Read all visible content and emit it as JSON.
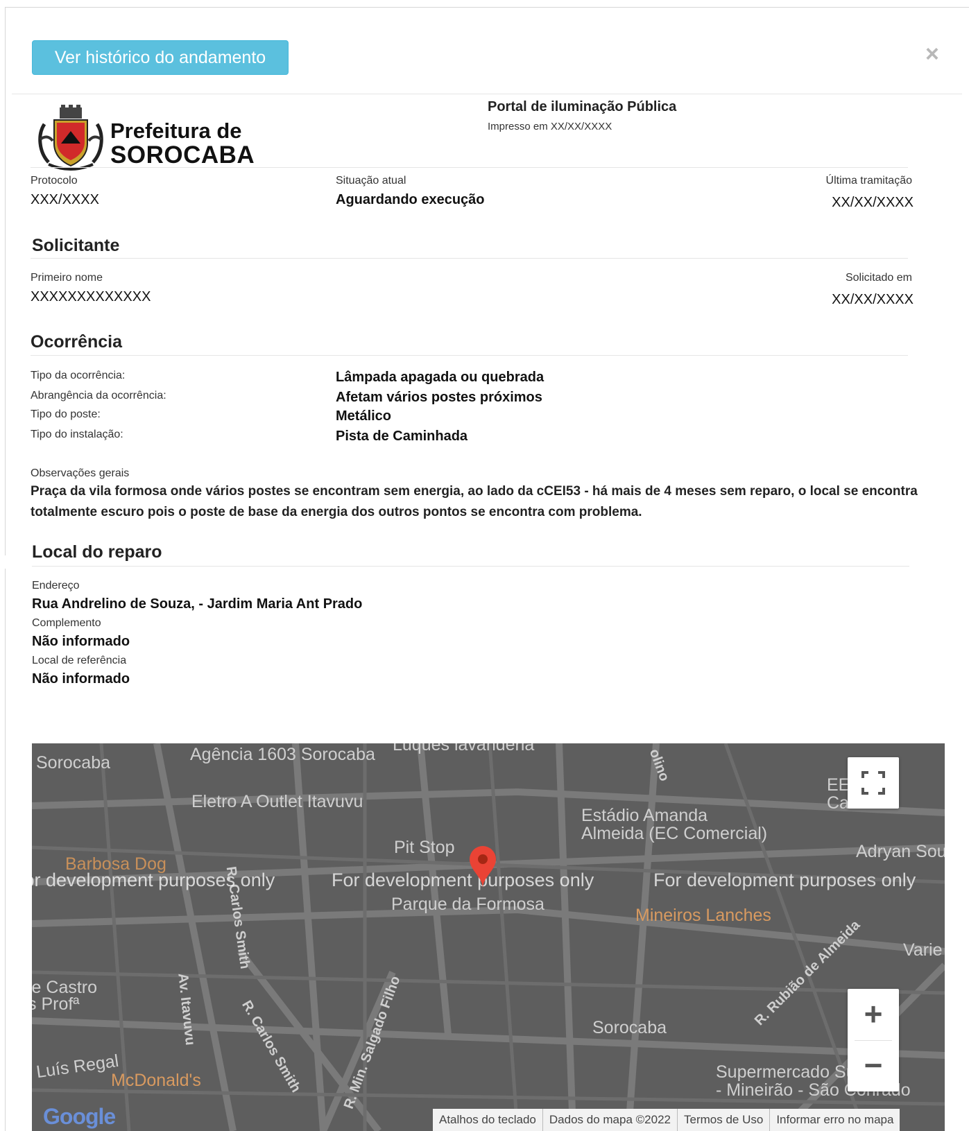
{
  "header": {
    "history_button": "Ver histórico do andamento",
    "close_symbol": "×"
  },
  "brand": {
    "line1": "Prefeitura de",
    "line2": "SOROCABA"
  },
  "portal": {
    "title": "Portal de iluminação Pública",
    "printed": "Impresso em XX/XX/XXXX"
  },
  "status": {
    "protocol_label": "Protocolo",
    "protocol_value": "XXX/XXXX",
    "situation_label": "Situação atual",
    "situation_value": "Aguardando execução",
    "last_label": "Última tramitação",
    "last_value": "XX/XX/XXXX"
  },
  "requester": {
    "heading": "Solicitante",
    "name_label": "Primeiro nome",
    "name_value": "XXXXXXXXXXXXX",
    "date_label": "Solicitado em",
    "date_value": "XX/XX/XXXX"
  },
  "occurrence": {
    "heading": "Ocorrência",
    "rows": [
      {
        "label": "Tipo da ocorrência:",
        "value": "Lâmpada apagada ou quebrada"
      },
      {
        "label": "Abrangência da ocorrência:",
        "value": "Afetam vários postes próximos"
      },
      {
        "label": "Tipo do poste:",
        "value": "Metálico"
      },
      {
        "label": "Tipo do instalação:",
        "value": "Pista de Caminhada"
      }
    ],
    "obs_label": "Observações gerais",
    "obs_value": "Praça da vila formosa onde vários postes se encontram sem energia, ao lado da cCEI53 - há mais de 4 meses sem reparo, o local se encontra totalmente escuro pois o poste de base da energia dos outros pontos se encontra com problema."
  },
  "location": {
    "heading": "Local do reparo",
    "address_label": "Endereço",
    "address_value": "Rua Andrelino de Souza, - Jardim Maria Ant Prado",
    "complement_label": "Complemento",
    "complement_value": "Não informado",
    "reference_label": "Local de referência",
    "reference_value": "Não informado"
  },
  "map": {
    "labels": {
      "sorocaba_top": "Sorocaba",
      "agencia": "Agência 1603 Sorocaba",
      "luques": "Luques lavanderia",
      "eletro": "Eletro A Outlet Itavuvu",
      "estadio1": "Estádio Amanda",
      "estadio2": "Almeida (EC Comercial)",
      "ee1": "EE Pro",
      "ee2": "Caixeir",
      "pitstop": "Pit Stop",
      "adryan": "Adryan Sou",
      "barbosa": "Barbosa Dog",
      "parque": "Parque da Formosa",
      "mineiros": "Mineiros Lanches",
      "varie": "Varie",
      "decastro1": "le Castro",
      "decastro2": "s Profª",
      "sorocaba_bottom": "Sorocaba",
      "luis": "Luís Regal",
      "mcd": "McDonald's",
      "super1": "Supermercado Supe",
      "super2": "- Mineirão - São Conrado",
      "itavuvu": "Av. Itavuvu",
      "carlos1": "R. Carlos Smith",
      "carlos2": "R. Carlos Smith",
      "salgado": "R. Min. Salgado Filho",
      "rubiao": "R. Rubião de Almeida",
      "olino": "olino"
    },
    "watermark": "For development purposes only",
    "google": "Google",
    "attribution": [
      "Atalhos do teclado",
      "Dados do mapa ©2022",
      "Termos de Uso",
      "Informar erro no mapa"
    ],
    "zoom_in": "+",
    "zoom_out": "−"
  }
}
